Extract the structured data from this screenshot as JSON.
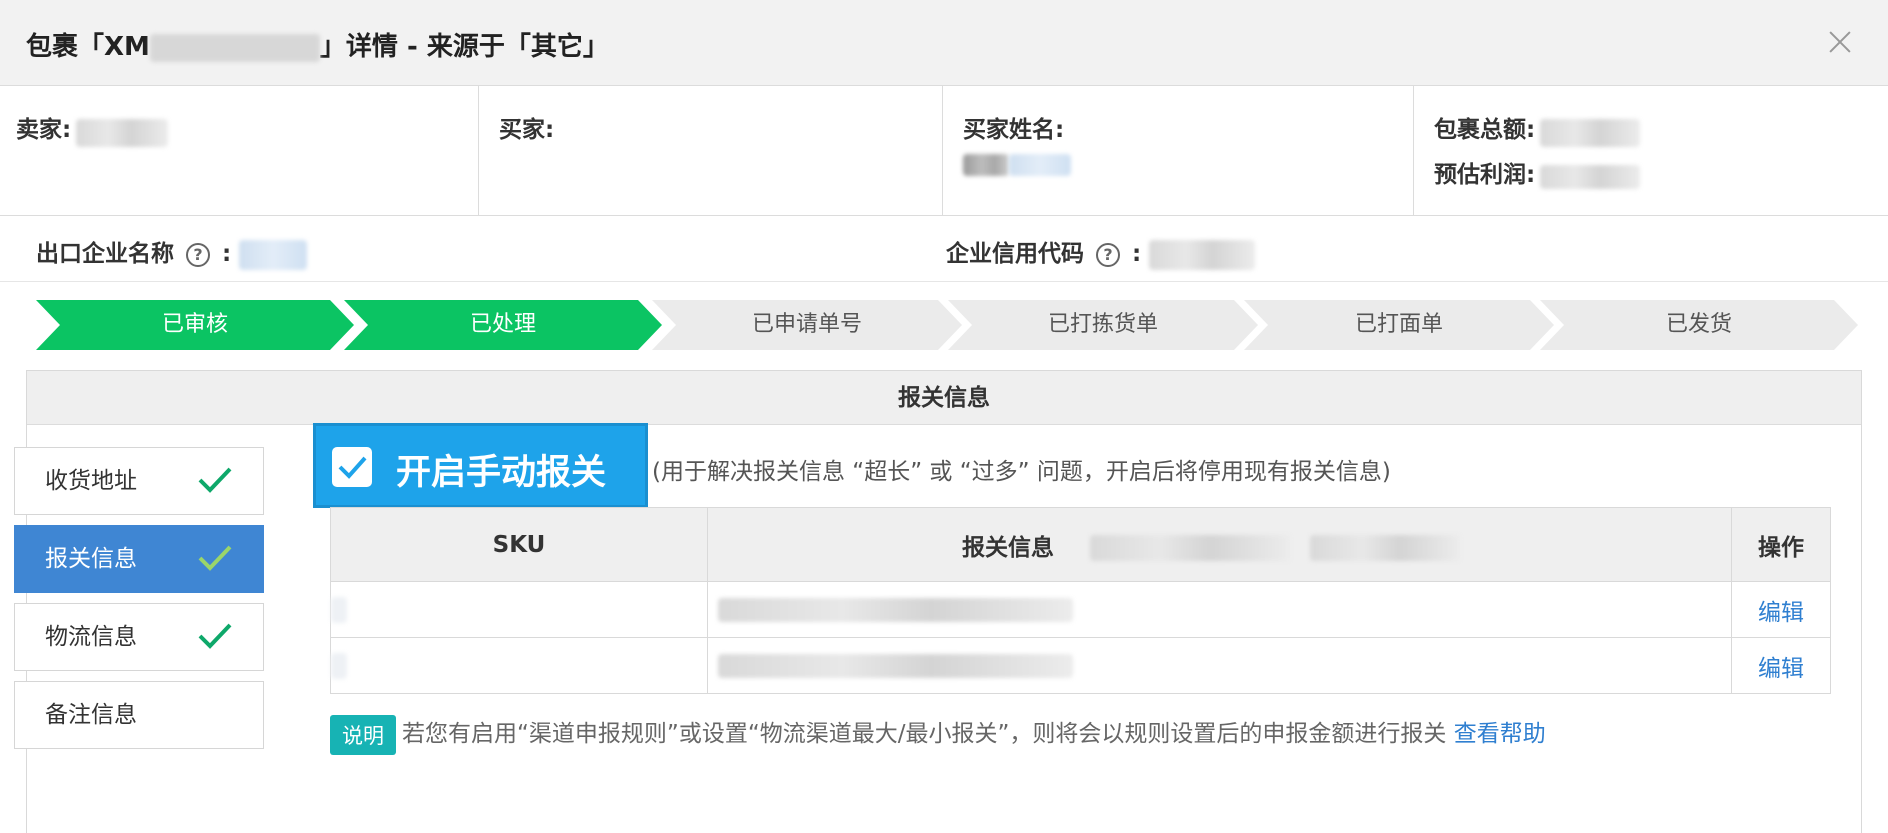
{
  "header": {
    "title_prefix": "包裹「XM",
    "title_suffix": "」详情 - 来源于「其它」"
  },
  "info": {
    "seller_label": "卖家:",
    "buyer_label": "买家:",
    "buyer_name_label": "买家姓名:",
    "package_total_label": "包裹总额:",
    "estimated_profit_label": "预估利润:"
  },
  "company": {
    "export_company_label": "出口企业名称",
    "credit_code_label": "企业信用代码",
    "colon": ":",
    "help_glyph": "?"
  },
  "steps": [
    {
      "label": "已审核",
      "status": "done"
    },
    {
      "label": "已处理",
      "status": "done"
    },
    {
      "label": "已申请单号",
      "status": "todo"
    },
    {
      "label": "已打拣货单",
      "status": "todo"
    },
    {
      "label": "已打面单",
      "status": "todo"
    },
    {
      "label": "已发货",
      "status": "todo"
    }
  ],
  "panel": {
    "title": "报关信息"
  },
  "sidebar": {
    "items": [
      {
        "label": "收货地址",
        "checked": true
      },
      {
        "label": "报关信息",
        "checked": true,
        "active": true
      },
      {
        "label": "物流信息",
        "checked": true
      },
      {
        "label": "备注信息",
        "checked": false
      }
    ]
  },
  "manual": {
    "label": "开启手动报关",
    "checked": true,
    "note": "(用于解决报关信息 “超长” 或 “过多” 问题，开启后将停用现有报关信息)"
  },
  "table": {
    "columns": [
      "SKU",
      "报关信息",
      "操作"
    ],
    "rows": [
      {
        "action": "编辑"
      },
      {
        "action": "编辑"
      }
    ]
  },
  "note": {
    "badge": "说明",
    "text": "若您有启用“渠道申报规则”或设置“物流渠道最大/最小报关”，则将会以规则设置后的申报金额进行报关",
    "link": "查看帮助"
  },
  "colors": {
    "green": "#0bc463",
    "active_blue": "#3f86d3",
    "checkbox_blue": "#1ea3ea",
    "link_blue": "#2f7fd0",
    "badge_teal": "#17b3b4"
  }
}
